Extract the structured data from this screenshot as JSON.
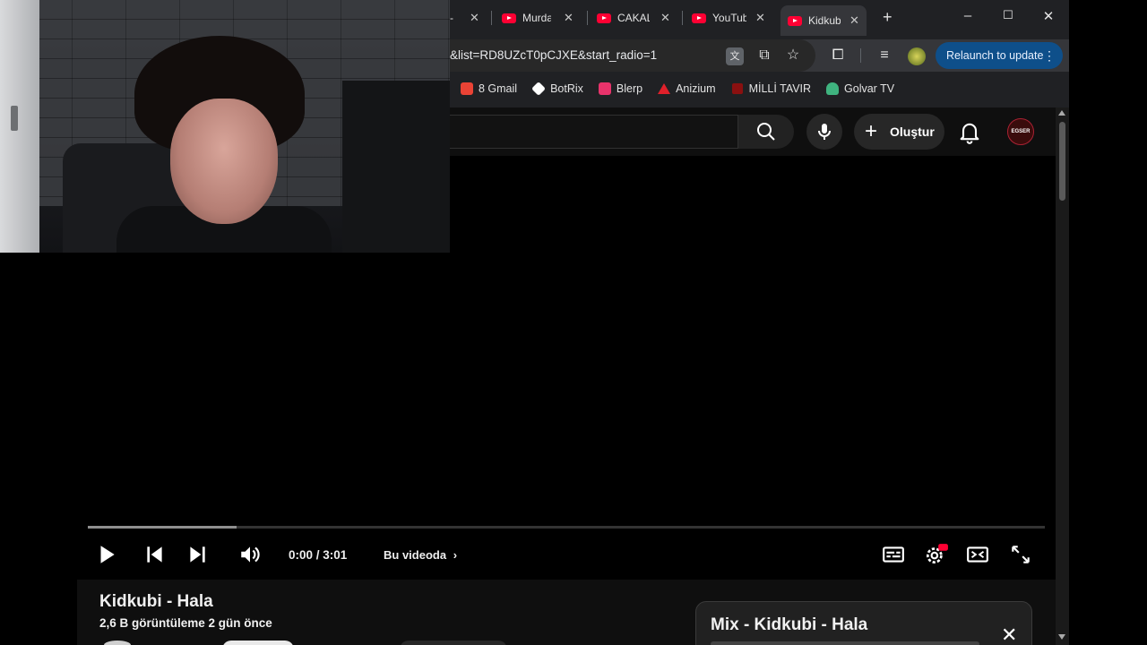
{
  "browser": {
    "tabs": [
      {
        "label": "Murda"
      },
      {
        "label": "CAKAL"
      },
      {
        "label": "YouTube"
      },
      {
        "label": "Kidkubi",
        "active": true
      }
    ],
    "new_tab_label": "+",
    "window_controls": {
      "minimize": "–",
      "maximize": "☐",
      "close": "✕"
    },
    "url": "&list=RD8UZcT0pCJXE&start_radio=1",
    "relaunch_label": "Relaunch to update",
    "bookmarks": [
      {
        "label": "8 Gmail",
        "icon": "gmail-icon",
        "color": "#ea4335"
      },
      {
        "label": "BotRix",
        "icon": "botrix-icon",
        "color": "#ffffff"
      },
      {
        "label": "Blerp",
        "icon": "blerp-icon",
        "color": "#e8336b"
      },
      {
        "label": "Anizium",
        "icon": "anizium-icon",
        "color": "#e0202a"
      },
      {
        "label": "MİLLİ TAVIR",
        "icon": "milli-tavir-icon",
        "color": "#8a1010"
      },
      {
        "label": "Golvar TV",
        "icon": "golvar-icon",
        "color": "#3fb37f"
      }
    ]
  },
  "youtube": {
    "create_label": "Oluştur",
    "avatar_text": "EGSER",
    "player": {
      "time": "0:00 / 3:01",
      "chapter_label": "Bu videoda",
      "buffered_fraction": 0.155
    },
    "video": {
      "title": "Kidkubi - Hala",
      "meta": "2,6 B görüntüleme  2 gün önce"
    },
    "mix": {
      "title": "Mix - Kidkubi - Hala"
    }
  },
  "colors": {
    "youtube_red": "#ff0033",
    "chrome_bg": "#202124",
    "relaunch_blue": "#0e4f8a"
  }
}
